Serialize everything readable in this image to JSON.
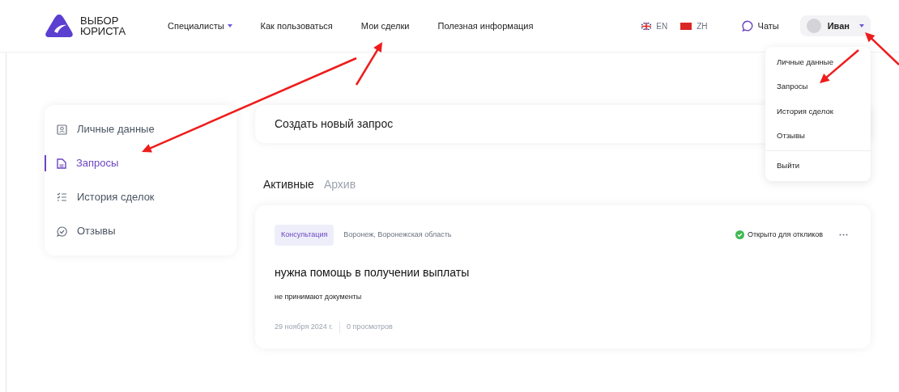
{
  "logo": {
    "line1": "ВЫБОР",
    "line2": "ЮРИСТА"
  },
  "nav": [
    {
      "label": "Специалисты",
      "dropdown": true
    },
    {
      "label": "Как пользоваться",
      "dropdown": false
    },
    {
      "label": "Мои сделки",
      "dropdown": false
    },
    {
      "label": "Полезная информация",
      "dropdown": false
    }
  ],
  "languages": [
    {
      "code": "EN",
      "kind": "uk"
    },
    {
      "code": "ZH",
      "kind": "cn"
    }
  ],
  "chats": "Чаты",
  "user": {
    "name": "Иван",
    "menu_open": true
  },
  "user_menu": [
    {
      "label": "Личные данные",
      "divider_before": false
    },
    {
      "label": "Запросы",
      "divider_before": false
    },
    {
      "label": "История сделок",
      "divider_before": false
    },
    {
      "label": "Отзывы",
      "divider_before": false
    },
    {
      "label": "Выйти",
      "divider_before": true
    }
  ],
  "sidebar": [
    {
      "label": "Личные данные",
      "kind": "person",
      "selected": false
    },
    {
      "label": "Запросы",
      "kind": "doc",
      "selected": true
    },
    {
      "label": "История сделок",
      "kind": "list",
      "selected": false
    },
    {
      "label": "Отзывы",
      "kind": "chat",
      "selected": false
    }
  ],
  "create_request": "Создать новый запрос",
  "tabs": [
    {
      "label": "Активные",
      "selected": true
    },
    {
      "label": "Архив",
      "selected": false
    }
  ],
  "requests": [
    {
      "tag": "Консультация",
      "location": "Воронеж, Воронежская область",
      "status": "Открыто для откликов",
      "title": "нужна помощь в получении выплаты",
      "description": "не принимают документы",
      "date": "29 ноября 2024 г.",
      "views": "0 просмотров"
    }
  ],
  "annotations": [
    {
      "kind": "arrow"
    },
    {
      "kind": "arrow"
    },
    {
      "kind": "arrow"
    },
    {
      "kind": "arrow"
    }
  ]
}
